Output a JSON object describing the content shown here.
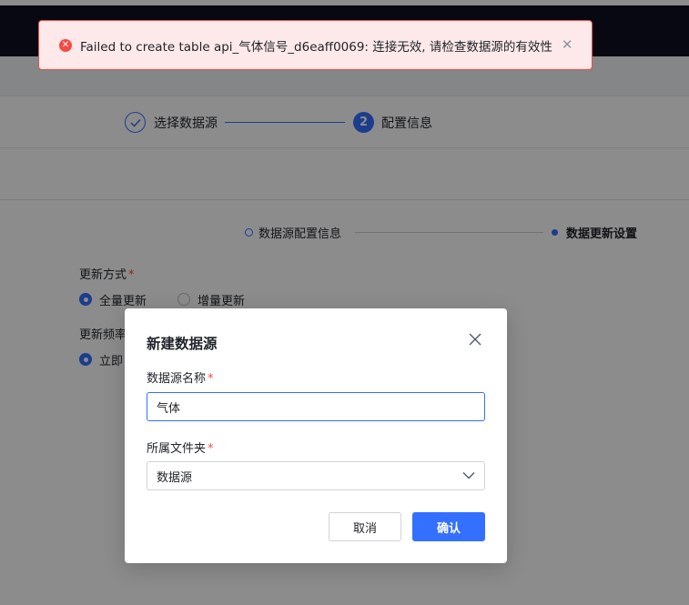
{
  "toast": {
    "icon": "error-circle-icon",
    "message": "Failed to create table api_气体信号_d6eaff0069: 连接无效, 请检查数据源的有效性",
    "close_glyph": "✕",
    "color": "#f54a45"
  },
  "stepper": {
    "steps": [
      {
        "label": "选择数据源",
        "state": "done"
      },
      {
        "label": "配置信息",
        "number": "2",
        "state": "active"
      }
    ]
  },
  "substeps": {
    "items": [
      {
        "label": "数据源配置信息",
        "state": "inactive"
      },
      {
        "label": "数据更新设置",
        "state": "active"
      }
    ]
  },
  "form": {
    "update_method": {
      "label": "更新方式",
      "required": "*",
      "options": [
        {
          "label": "全量更新",
          "selected": true
        },
        {
          "label": "增量更新",
          "selected": false
        }
      ]
    },
    "update_frequency": {
      "label_visible": "更新频率",
      "option_visible": "立即"
    }
  },
  "modal": {
    "title": "新建数据源",
    "name_field": {
      "label": "数据源名称",
      "required": "*",
      "value": "气体"
    },
    "folder_field": {
      "label": "所属文件夹",
      "required": "*",
      "value": "数据源"
    },
    "cancel_label": "取消",
    "confirm_label": "确认"
  },
  "colors": {
    "accent": "#3370ff",
    "error": "#f54a45",
    "topbar": "#0d1021"
  }
}
